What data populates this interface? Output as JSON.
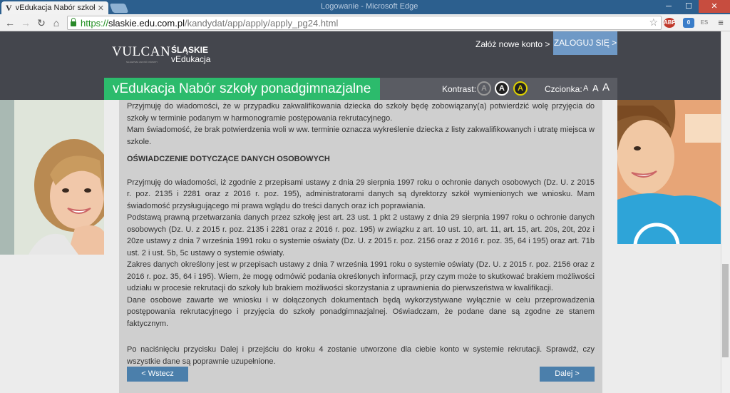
{
  "browser": {
    "tab_title": "vEdukacja Nabór szkoły po",
    "tab_favicon": "V",
    "window_title": "Logowanie - Microsoft Edge",
    "url_scheme": "https://",
    "url_host": "slaskie.edu.com.pl",
    "url_path": "/kandydat/app/apply/apply_pg24.html",
    "extensions": [
      "ABP",
      "0",
      "ES"
    ]
  },
  "header": {
    "logo_vulcan": "VULCAN",
    "logo_vulcan_sub": "NAJLEPSZA JAKOŚĆ OŚWIATY",
    "logo_slaskie": "ŚLĄSKIE",
    "logo_vedu": "vEdukacja",
    "new_account": "Załóż nowe konto >",
    "login": "ZALOGUJ SIĘ >",
    "page_title": "vEdukacja Nabór szkoły ponadgimnazjalne",
    "contrast_label": "Kontrast:",
    "contrast_options": [
      "A",
      "A",
      "A"
    ],
    "font_label": "Czcionka:",
    "font_options": [
      "A",
      "A",
      "A"
    ]
  },
  "content": {
    "p1": "Przyjmuję do wiadomości, że w przypadku zakwalifikowania dziecka do szkoły będę zobowiązany(a) potwierdzić wolę przyjęcia do szkoły w terminie podanym w harmonogramie postępowania rekrutacyjnego.",
    "p2": "Mam świadomość, że brak potwierdzenia woli w ww. terminie oznacza wykreślenie dziecka z listy zakwalifikowanych i utratę miejsca w szkole.",
    "heading": "OŚWIADCZENIE DOTYCZĄCE DANYCH OSOBOWYCH",
    "p3": "Przyjmuję do wiadomości, iż zgodnie z przepisami ustawy z dnia 29 sierpnia 1997 roku o ochronie danych osobowych (Dz. U. z 2015 r. poz. 2135 i 2281 oraz z 2016 r. poz. 195), administratorami danych są dyrektorzy szkół wymienionych we wniosku. Mam świadomość przysługującego mi prawa wglądu do treści danych oraz ich poprawiania.",
    "p4": "Podstawą prawną przetwarzania danych przez szkołę jest art. 23 ust. 1 pkt 2 ustawy z dnia 29 sierpnia 1997 roku o ochronie danych osobowych (Dz. U. z 2015 r. poz. 2135 i 2281 oraz z 2016 r. poz. 195) w związku z art. 10 ust. 10, art. 11, art. 15, art. 20s, 20t, 20z i 20ze ustawy z dnia 7 września 1991 roku o systemie oświaty (Dz. U. z 2015 r. poz. 2156 oraz z 2016 r. poz. 35, 64 i 195) oraz art. 71b ust. 2 i ust. 5b, 5c ustawy o systemie oświaty.",
    "p5": "Zakres danych określony jest w przepisach ustawy z dnia 7 września 1991 roku o systemie oświaty (Dz. U. z 2015 r. poz. 2156 oraz z 2016 r. poz. 35, 64 i 195). Wiem, że mogę odmówić podania określonych informacji, przy czym może to skutkować brakiem możliwości udziału w procesie rekrutacji do szkoły lub brakiem możliwości skorzystania z uprawnienia do pierwszeństwa w kwalifikacji.",
    "p6": "Dane osobowe zawarte we wniosku i w dołączonych dokumentach będą wykorzystywane wyłącznie w celu przeprowadzenia postępowania rekrutacyjnego i przyjęcia do szkoły ponadgimnazjalnej. Oświadczam, że podane dane są zgodne ze stanem faktycznym.",
    "p7": "Po naciśnięciu przycisku Dalej i przejściu do kroku 4 zostanie utworzone dla ciebie konto w systemie rekrutacji. Sprawdź, czy wszystkie dane są poprawnie uzupełnione.",
    "back": "< Wstecz",
    "next": "Dalej >"
  },
  "colors": {
    "header_bg": "#44464d",
    "title_green": "#2cbb6c",
    "login_blue": "#6f99c6",
    "button_blue": "#4b7fab",
    "content_bg": "#cfcfcf"
  }
}
